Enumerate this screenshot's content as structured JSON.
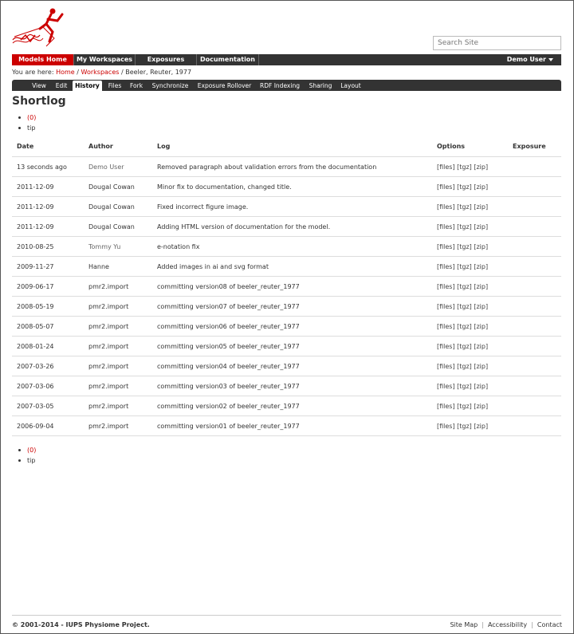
{
  "header": {
    "search_placeholder": "Search Site"
  },
  "nav": {
    "items": [
      {
        "label": "Models Home",
        "active": true
      },
      {
        "label": "My Workspaces",
        "active": false
      },
      {
        "label": "Exposures",
        "active": false
      },
      {
        "label": "Documentation",
        "active": false
      }
    ],
    "user_label": "Demo User"
  },
  "breadcrumb": {
    "prefix": "You are here:",
    "home": "Home",
    "sep1": "/",
    "workspaces": "Workspaces",
    "sep2": "/",
    "current": "Beeler, Reuter, 1977"
  },
  "tabs": [
    {
      "label": "View",
      "active": false
    },
    {
      "label": "Edit",
      "active": false
    },
    {
      "label": "History",
      "active": true
    },
    {
      "label": "Files",
      "active": false
    },
    {
      "label": "Fork",
      "active": false
    },
    {
      "label": "Synchronize",
      "active": false
    },
    {
      "label": "Exposure Rollover",
      "active": false
    },
    {
      "label": "RDF Indexing",
      "active": false
    },
    {
      "label": "Sharing",
      "active": false
    },
    {
      "label": "Layout",
      "active": false
    }
  ],
  "page_title": "Shortlog",
  "pager_top": {
    "zero": "(0)",
    "tip": "tip"
  },
  "pager_bottom": {
    "zero": "(0)",
    "tip": "tip"
  },
  "table": {
    "headers": {
      "date": "Date",
      "author": "Author",
      "log": "Log",
      "options": "Options",
      "exposure": "Exposure"
    },
    "options_labels": {
      "files": "[files]",
      "tgz": "[tgz]",
      "zip": "[zip]"
    },
    "rows": [
      {
        "date": "13 seconds ago",
        "author": "Demo User",
        "author_link": true,
        "log": "Removed paragraph about validation errors from the documentation"
      },
      {
        "date": "2011-12-09",
        "author": "Dougal Cowan",
        "author_link": false,
        "log": "Minor fix to documentation, changed title."
      },
      {
        "date": "2011-12-09",
        "author": "Dougal Cowan",
        "author_link": false,
        "log": "Fixed incorrect figure image."
      },
      {
        "date": "2011-12-09",
        "author": "Dougal Cowan",
        "author_link": false,
        "log": "Adding HTML version of documentation for the model."
      },
      {
        "date": "2010-08-25",
        "author": "Tommy Yu",
        "author_link": true,
        "log": "e-notation fix"
      },
      {
        "date": "2009-11-27",
        "author": "Hanne",
        "author_link": false,
        "log": "Added images in ai and svg format"
      },
      {
        "date": "2009-06-17",
        "author": "pmr2.import",
        "author_link": false,
        "log": "committing version08 of beeler_reuter_1977"
      },
      {
        "date": "2008-05-19",
        "author": "pmr2.import",
        "author_link": false,
        "log": "committing version07 of beeler_reuter_1977"
      },
      {
        "date": "2008-05-07",
        "author": "pmr2.import",
        "author_link": false,
        "log": "committing version06 of beeler_reuter_1977"
      },
      {
        "date": "2008-01-24",
        "author": "pmr2.import",
        "author_link": false,
        "log": "committing version05 of beeler_reuter_1977"
      },
      {
        "date": "2007-03-26",
        "author": "pmr2.import",
        "author_link": false,
        "log": "committing version04 of beeler_reuter_1977"
      },
      {
        "date": "2007-03-06",
        "author": "pmr2.import",
        "author_link": false,
        "log": "committing version03 of beeler_reuter_1977"
      },
      {
        "date": "2007-03-05",
        "author": "pmr2.import",
        "author_link": false,
        "log": "committing version02 of beeler_reuter_1977"
      },
      {
        "date": "2006-09-04",
        "author": "pmr2.import",
        "author_link": false,
        "log": "committing version01 of beeler_reuter_1977"
      }
    ]
  },
  "footer": {
    "copyright": "© 2001-2014 - IUPS Physiome Project.",
    "links": [
      "Site Map",
      "Accessibility",
      "Contact"
    ]
  },
  "colors": {
    "accent": "#cc0000",
    "navbar": "#333333"
  }
}
